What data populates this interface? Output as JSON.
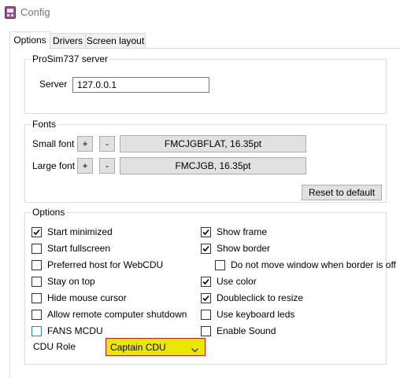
{
  "window": {
    "title": "Config",
    "app_icon": "config-app-icon"
  },
  "tabs": [
    {
      "label": "Options",
      "active": true
    },
    {
      "label": "Drivers",
      "active": false
    },
    {
      "label": "Screen layout",
      "active": false
    }
  ],
  "server_group": {
    "title": "ProSim737 server",
    "server_label": "Server",
    "server_value": "127.0.0.1"
  },
  "fonts_group": {
    "title": "Fonts",
    "small_label": "Small font",
    "small_plus": "+",
    "small_minus": "-",
    "small_value": "FMCJGBFLAT, 16.35pt",
    "large_label": "Large font",
    "large_plus": "+",
    "large_minus": "-",
    "large_value": "FMCJGB, 16.35pt",
    "reset_label": "Reset to default"
  },
  "options_group": {
    "title": "Options",
    "left": [
      {
        "label": "Start minimized",
        "checked": true
      },
      {
        "label": "Start fullscreen",
        "checked": false
      },
      {
        "label": "Preferred host for WebCDU",
        "checked": false
      },
      {
        "label": "Stay on top",
        "checked": false
      },
      {
        "label": "Hide mouse cursor",
        "checked": false
      },
      {
        "label": "Allow remote computer shutdown",
        "checked": false
      },
      {
        "label": "FANS MCDU",
        "checked": false,
        "focused": true
      }
    ],
    "right": [
      {
        "label": "Show frame",
        "checked": true
      },
      {
        "label": "Show border",
        "checked": true
      },
      {
        "label": "Do not move window when border is off",
        "checked": false
      },
      {
        "label": "Use color",
        "checked": true
      },
      {
        "label": "Doubleclick to resize",
        "checked": true
      },
      {
        "label": "Use keyboard leds",
        "checked": false
      },
      {
        "label": "Enable Sound",
        "checked": false
      }
    ],
    "cdu_role_label": "CDU Role",
    "cdu_role_value": "Captain CDU"
  },
  "colors": {
    "highlight_yellow": "#e8e800",
    "highlight_border": "#d62020",
    "focus_blue": "#1e88c8"
  }
}
